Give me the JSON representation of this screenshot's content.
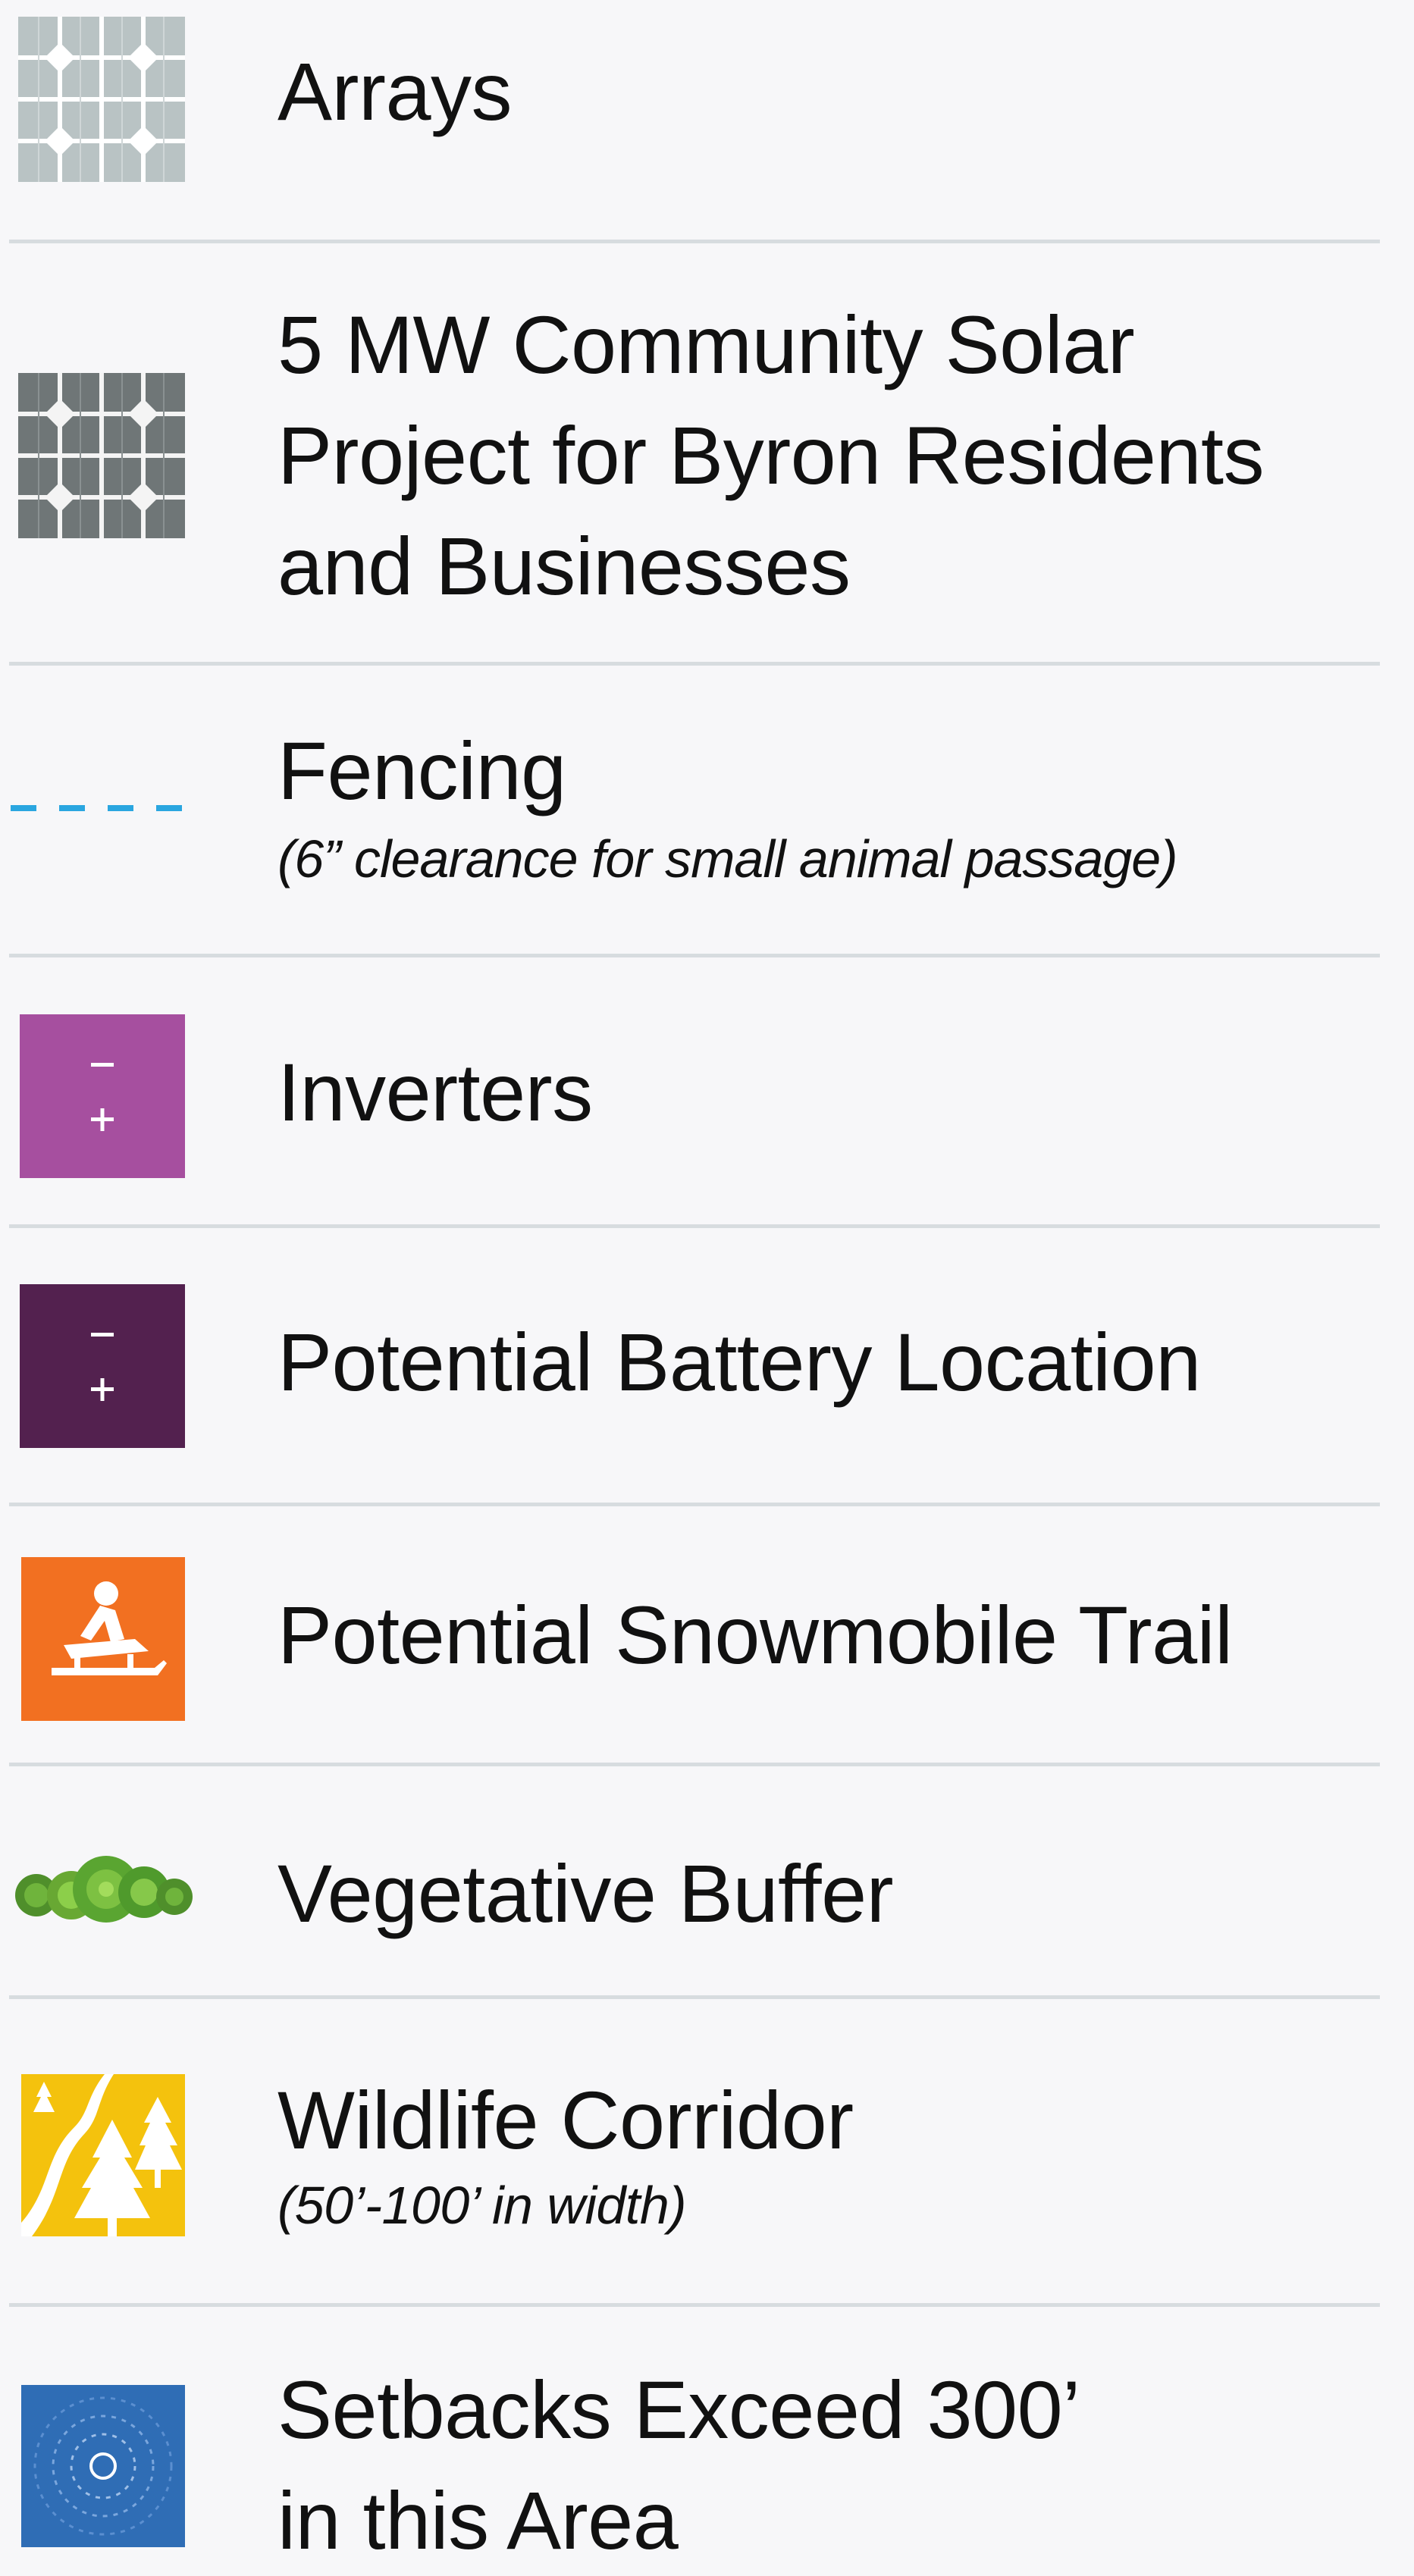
{
  "legend": [
    {
      "id": "arrays",
      "label": "Arrays",
      "icon": "solar-panel-light-icon",
      "color": "#b9c3c4"
    },
    {
      "id": "community",
      "label_lines": [
        "5 MW Community Solar",
        "Project for Byron Residents",
        "and Businesses"
      ],
      "icon": "solar-panel-dark-icon",
      "color": "#6f7677"
    },
    {
      "id": "fencing",
      "label": "Fencing",
      "sublabel": "(6” clearance for small animal passage)",
      "icon": "dashed-line-icon",
      "color": "#2aa6e0"
    },
    {
      "id": "inverters",
      "label": "Inverters",
      "icon": "inverter-icon",
      "color": "#a64f9f"
    },
    {
      "id": "battery",
      "label": "Potential Battery Location",
      "icon": "battery-icon",
      "color": "#53214f"
    },
    {
      "id": "snowmobile",
      "label": "Potential Snowmobile Trail",
      "icon": "snowmobile-icon",
      "color": "#f27021"
    },
    {
      "id": "vegetative",
      "label": "Vegetative Buffer",
      "icon": "shrubs-icon",
      "color": "#5aa531"
    },
    {
      "id": "wildlife",
      "label": "Wildlife Corridor",
      "sublabel": "(50’-100’ in width)",
      "icon": "trees-path-icon",
      "color": "#f4c20d"
    },
    {
      "id": "setbacks",
      "label_lines": [
        "Setbacks Exceed 300’",
        "in this Area"
      ],
      "icon": "setback-radius-icon",
      "color": "#2f6db5"
    }
  ]
}
